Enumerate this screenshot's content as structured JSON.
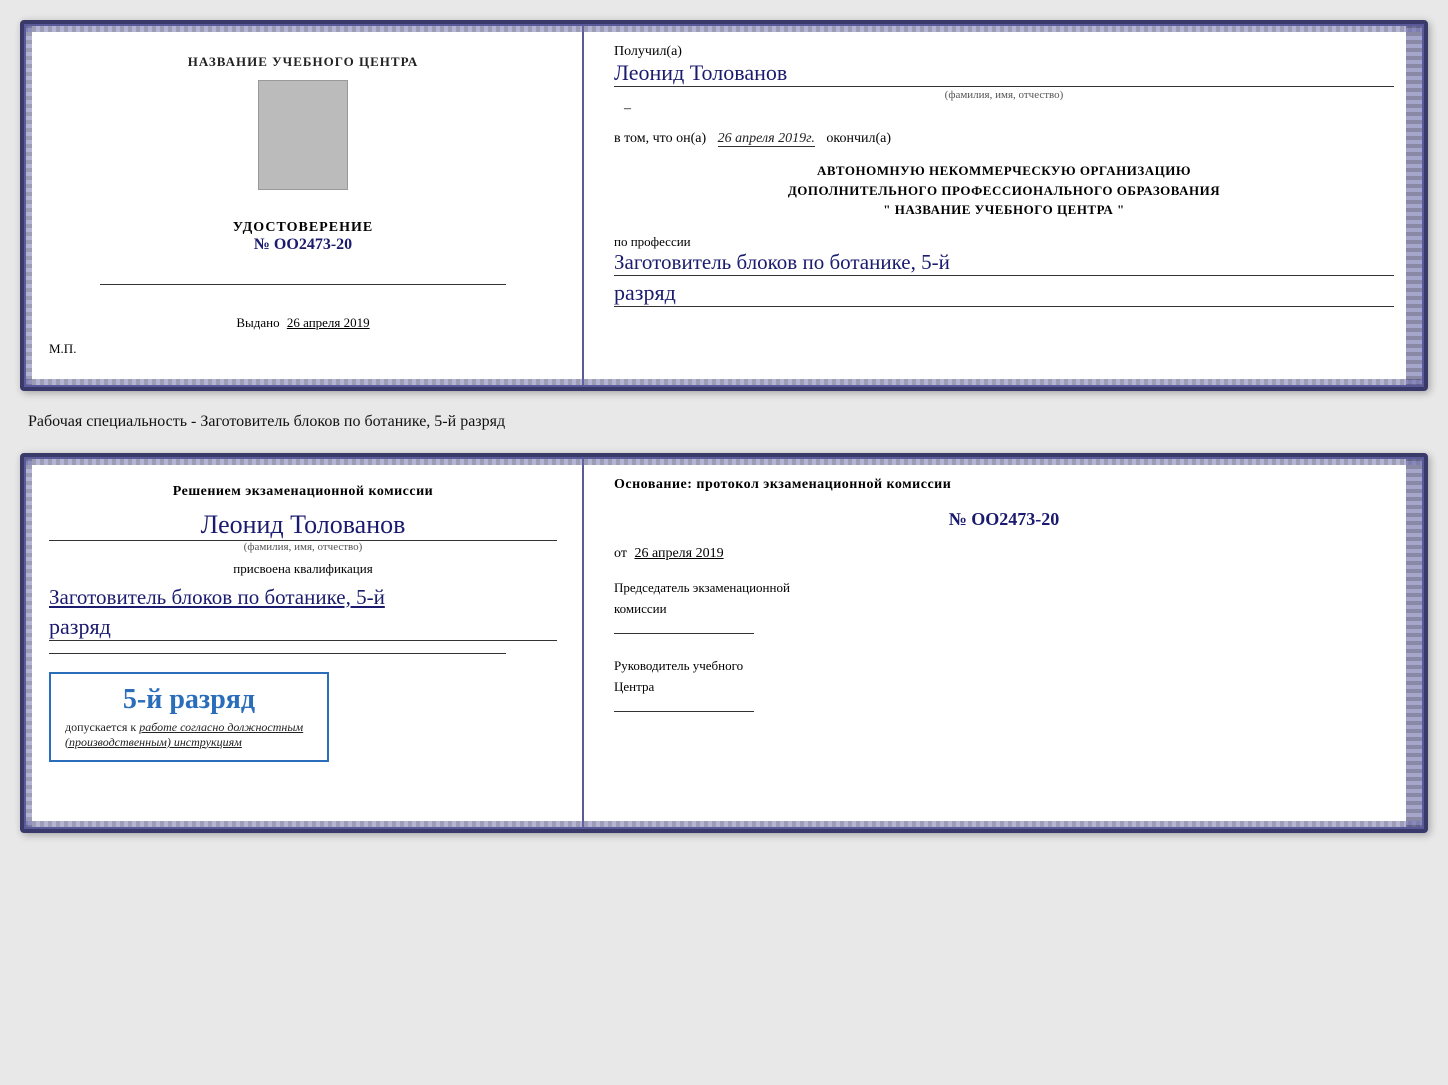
{
  "card1": {
    "left": {
      "training_center_label": "НАЗВАНИЕ УЧЕБНОГО ЦЕНТРА",
      "udost_title": "УДОСТОВЕРЕНИЕ",
      "number": "№ OO2473-20",
      "vydano_label": "Выдано",
      "vydano_date": "26 апреля 2019",
      "mp_label": "М.П."
    },
    "right": {
      "poluchil_prefix": "Получил(а)",
      "recipient_name": "Леонид Толованов",
      "fio_label": "(фамилия, имя, отчество)",
      "dash": "–",
      "vtom_prefix": "в том, что он(а)",
      "date_italic": "26 апреля 2019г.",
      "okonchil": "окончил(а)",
      "org_line1": "АВТОНОМНУЮ НЕКОММЕРЧЕСКУЮ ОРГАНИЗАЦИЮ",
      "org_line2": "ДОПОЛНИТЕЛЬНОГО ПРОФЕССИОНАЛЬНОГО ОБРАЗОВАНИЯ",
      "org_line3": "\"  НАЗВАНИЕ УЧЕБНОГО ЦЕНТРА  \"",
      "po_professii": "по профессии",
      "profession": "Заготовитель блоков по ботанике, 5-й",
      "razryad": "разряд"
    }
  },
  "subtitle": "Рабочая специальность - Заготовитель блоков по ботанике, 5-й разряд",
  "card2": {
    "left": {
      "decision_line1": "Решением экзаменационной комиссии",
      "person_name": "Леонид Толованов",
      "fio_label": "(фамилия, имя, отчество)",
      "prisvoena": "присвоена квалификация",
      "qual_name": "Заготовитель блоков по ботанике, 5-й",
      "razryad": "разряд",
      "stamp_grade": "5-й разряд",
      "stamp_allowed_prefix": "допускается к",
      "stamp_allowed_italic": "работе согласно должностным",
      "stamp_allowed_italic2": "(производственным) инструкциям"
    },
    "right": {
      "osnov_label": "Основание: протокол экзаменационной комиссии",
      "number_label": "№ OO2473-20",
      "ot_prefix": "от",
      "ot_date": "26 апреля 2019",
      "chairman_line1": "Председатель экзаменационной",
      "chairman_line2": "комиссии",
      "rukov_line1": "Руководитель учебного",
      "rukov_line2": "Центра"
    }
  }
}
